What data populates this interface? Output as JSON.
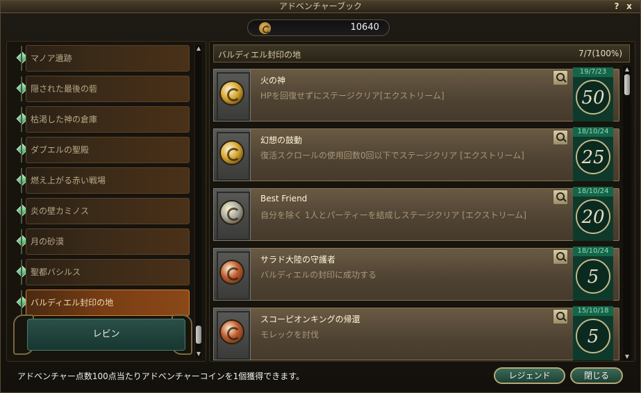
{
  "window": {
    "title": "アドベンチャーブック",
    "help_label": "?",
    "close_label": "x"
  },
  "points": {
    "value": "10640",
    "icon": "coin-icon"
  },
  "sidebar": {
    "items": [
      {
        "label": "マノア遺跡",
        "selected": false
      },
      {
        "label": "隠された最後の砦",
        "selected": false
      },
      {
        "label": "枯渇した神の倉庫",
        "selected": false
      },
      {
        "label": "ダブエルの聖殿",
        "selected": false
      },
      {
        "label": "燃え上がる赤い戦場",
        "selected": false
      },
      {
        "label": "炎の壁カミノス",
        "selected": false
      },
      {
        "label": "月の砂漠",
        "selected": false
      },
      {
        "label": "聖都バシルス",
        "selected": false
      },
      {
        "label": "バルディエル封印の地",
        "selected": true
      }
    ],
    "class_tab": "レビン"
  },
  "zone": {
    "title": "バルディエル封印の地",
    "progress": "7/7(100%)"
  },
  "achievements": [
    {
      "name": "火の神",
      "desc": "HPを回復せずにステージクリア[エクストリーム]",
      "date": "19/7/23",
      "score": "50",
      "medal": "gold"
    },
    {
      "name": "幻想の鼓動",
      "desc": "復活スクロールの使用回数0回以下でステージクリア [エクストリーム]",
      "date": "18/10/24",
      "score": "25",
      "medal": "gold"
    },
    {
      "name": "Best Friend",
      "desc": "自分を除く 1人とパーティーを結成しステージクリア [エクストリーム]",
      "date": "18/10/24",
      "score": "20",
      "medal": "silver"
    },
    {
      "name": "サラド大陸の守護者",
      "desc": "バルディエルの封印に成功する",
      "date": "18/10/24",
      "score": "5",
      "medal": "bronze"
    },
    {
      "name": "スコーピオンキングの帰還",
      "desc": "モレックを討伐",
      "date": "15/10/18",
      "score": "5",
      "medal": "bronze"
    }
  ],
  "medal_colors": {
    "gold": "#d8a830",
    "silver": "#a8aca0",
    "bronze": "#c05a30"
  },
  "footer": {
    "note": "アドベンチャー点数100点当たりアドベンチャーコインを1個獲得できます。",
    "legend_button": "レジェンド",
    "close_button": "閉じる"
  }
}
